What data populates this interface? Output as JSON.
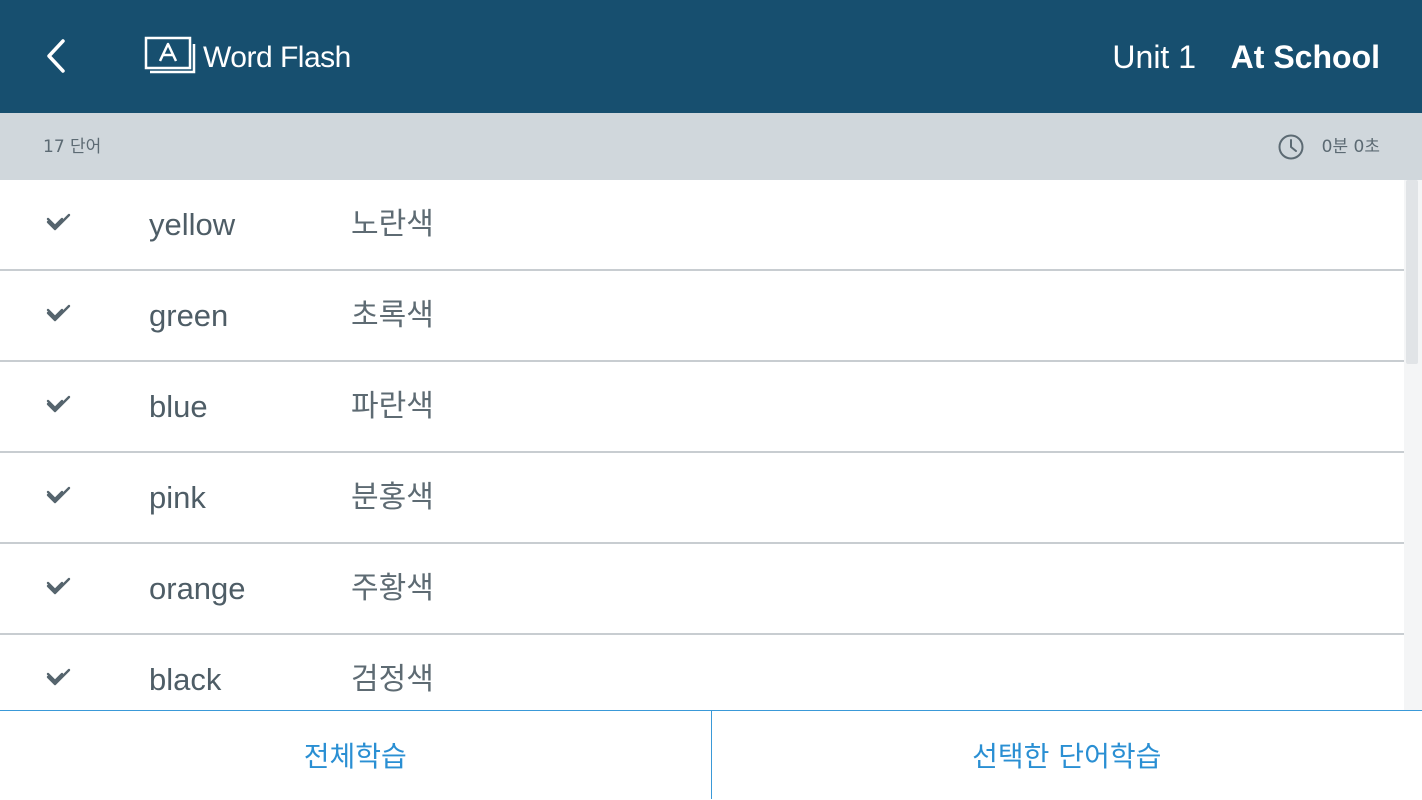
{
  "header": {
    "app_title": "Word Flash",
    "unit_label": "Unit 1",
    "unit_title": "At School"
  },
  "info_bar": {
    "word_count": "17 단어",
    "timer": "0분 0초"
  },
  "words": [
    {
      "word": "yellow",
      "meaning": "노란색"
    },
    {
      "word": "green",
      "meaning": "초록색"
    },
    {
      "word": "blue",
      "meaning": "파란색"
    },
    {
      "word": "pink",
      "meaning": "분홍색"
    },
    {
      "word": "orange",
      "meaning": "주황색"
    },
    {
      "word": "black",
      "meaning": "검정색"
    }
  ],
  "buttons": {
    "study_all": "전체학습",
    "study_selected": "선택한 단어학습"
  },
  "icons": {
    "back": "chevron-left-icon",
    "logo": "flashcard-icon",
    "timer": "clock-icon",
    "check": "double-check-icon"
  },
  "colors": {
    "header_bg": "#174f6f",
    "info_bar_bg": "#d0d7dc",
    "accent": "#2a8fd3"
  }
}
